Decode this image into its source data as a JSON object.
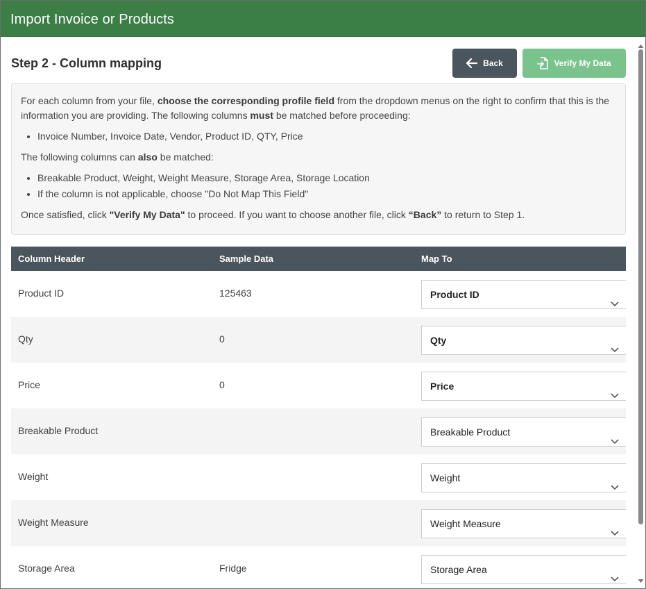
{
  "window": {
    "title": "Import Invoice or Products"
  },
  "step": {
    "title": "Step 2 - Column mapping"
  },
  "buttons": {
    "back_label": "Back",
    "verify_label": "Verify My Data"
  },
  "info": {
    "p1_a": "For each column from your file, ",
    "p1_b": "choose the corresponding profile field",
    "p1_c": " from the dropdown menus on the right to confirm that this is the information you are providing. The following columns ",
    "p1_d": "must",
    "p1_e": " be matched before proceeding:",
    "required_item": "Invoice Number, Invoice Date, Vendor, Product ID, QTY, Price",
    "p2_a": "The following columns can ",
    "p2_b": "also",
    "p2_c": " be matched:",
    "optional_item_1": "Breakable Product, Weight, Weight Measure, Storage Area, Storage Location",
    "optional_item_2": "If the column is not applicable, choose \"Do Not Map This Field\"",
    "p3_a": "Once satisfied, click ",
    "p3_b": "\"Verify My Data\"",
    "p3_c": " to proceed. If you want to choose another file, click ",
    "p3_d": "“Back”",
    "p3_e": " to return to Step 1."
  },
  "table": {
    "headers": {
      "col1": "Column Header",
      "col2": "Sample Data",
      "col3": "Map To"
    },
    "rows": [
      {
        "header": "Product ID",
        "sample": "125463",
        "map_to": "Product ID"
      },
      {
        "header": "Qty",
        "sample": "0",
        "map_to": "Qty"
      },
      {
        "header": "Price",
        "sample": "0",
        "map_to": "Price"
      },
      {
        "header": "Breakable Product",
        "sample": "",
        "map_to": "Breakable Product"
      },
      {
        "header": "Weight",
        "sample": "",
        "map_to": "Weight"
      },
      {
        "header": "Weight Measure",
        "sample": "",
        "map_to": "Weight Measure"
      },
      {
        "header": "Storage Area",
        "sample": "Fridge",
        "map_to": "Storage Area"
      }
    ]
  },
  "colors": {
    "titlebar": "#3b7f47",
    "back_button": "#4b555d",
    "verify_button": "#7ac38d",
    "table_header": "#4b555d"
  },
  "icons": {
    "back": "arrow-left-icon",
    "verify": "file-import-icon",
    "dropdown": "chevron-down-icon"
  }
}
